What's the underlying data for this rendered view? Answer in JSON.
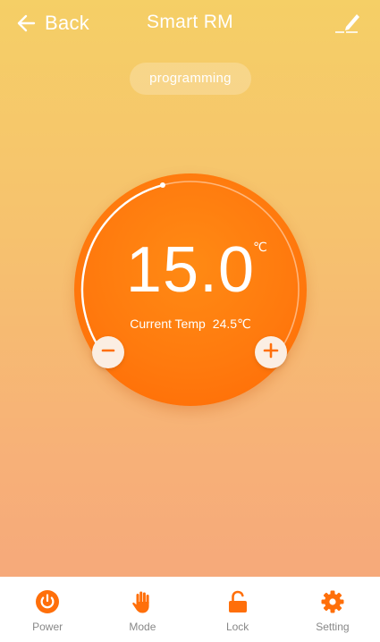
{
  "header": {
    "back_label": "Back",
    "title": "Smart RM"
  },
  "mode": {
    "label": "programming"
  },
  "thermostat": {
    "set_temp": "15.0",
    "unit": "℃",
    "current_label": "Current Temp",
    "current_value": "24.5℃",
    "dial_progress_fraction": 0.62
  },
  "tabs": [
    {
      "label": "Power",
      "icon": "power-icon"
    },
    {
      "label": "Mode",
      "icon": "hand-icon"
    },
    {
      "label": "Lock",
      "icon": "unlock-icon"
    },
    {
      "label": "Setting",
      "icon": "gear-icon"
    }
  ],
  "colors": {
    "accent": "#ff6f0a",
    "background_top": "#f5cf66",
    "background_bottom": "#f6a97a",
    "tab_label": "#888888"
  }
}
